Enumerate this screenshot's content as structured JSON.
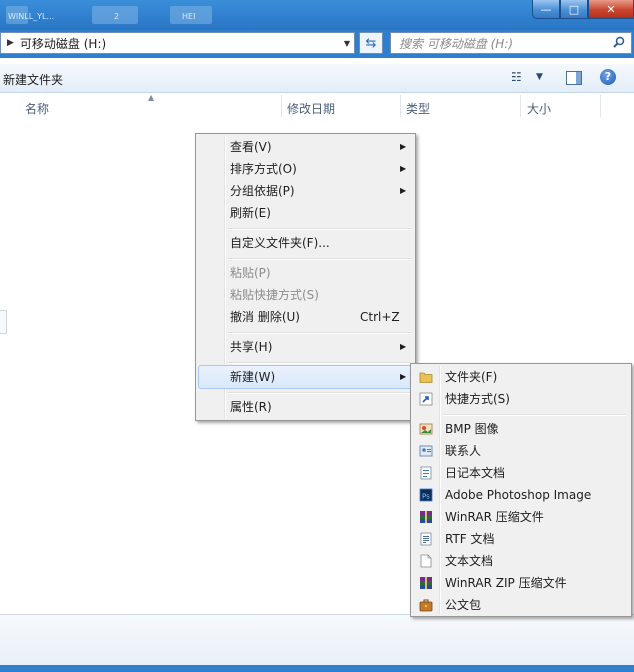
{
  "window": {
    "title_fragments": [
      "WINLL_YL...",
      "2",
      "HEI"
    ],
    "buttons": {
      "minimize": "—",
      "maximize": "□",
      "close": "✕"
    }
  },
  "address": {
    "path": "可移动磁盘 (H:)",
    "search_placeholder": "搜索 可移动磁盘 (H:)"
  },
  "toolbar": {
    "new_folder": "新建文件夹"
  },
  "columns": [
    "名称",
    "修改日期",
    "类型",
    "大小"
  ],
  "context_menu": {
    "items": [
      {
        "label": "查看(V)",
        "submenu": true
      },
      {
        "label": "排序方式(O)",
        "submenu": true
      },
      {
        "label": "分组依据(P)",
        "submenu": true
      },
      {
        "label": "刷新(E)"
      },
      {
        "label": "自定义文件夹(F)..."
      },
      {
        "label": "粘贴(P)",
        "disabled": true
      },
      {
        "label": "粘贴快捷方式(S)",
        "disabled": true
      },
      {
        "label": "撤消 删除(U)",
        "shortcut": "Ctrl+Z"
      },
      {
        "label": "共享(H)",
        "submenu": true
      },
      {
        "label": "新建(W)",
        "submenu": true,
        "highlighted": true
      },
      {
        "label": "属性(R)"
      }
    ]
  },
  "new_submenu": {
    "items": [
      {
        "label": "文件夹(F)",
        "icon": "folder-icon"
      },
      {
        "label": "快捷方式(S)",
        "icon": "shortcut-icon"
      },
      {
        "label": "BMP 图像",
        "icon": "bmp-image-icon"
      },
      {
        "label": "联系人",
        "icon": "contact-icon"
      },
      {
        "label": "日记本文档",
        "icon": "journal-icon"
      },
      {
        "label": "Adobe Photoshop Image",
        "icon": "photoshop-icon"
      },
      {
        "label": "WinRAR 压缩文件",
        "icon": "winrar-icon"
      },
      {
        "label": "RTF 文档",
        "icon": "rtf-document-icon"
      },
      {
        "label": "文本文档",
        "icon": "text-document-icon"
      },
      {
        "label": "WinRAR ZIP 压缩文件",
        "icon": "winrar-zip-icon"
      },
      {
        "label": "公文包",
        "icon": "briefcase-icon"
      }
    ]
  },
  "colors": {
    "accent": "#2f7fcf",
    "menu_bg": "#f0f0f0",
    "highlight": "#d9e8fb"
  }
}
